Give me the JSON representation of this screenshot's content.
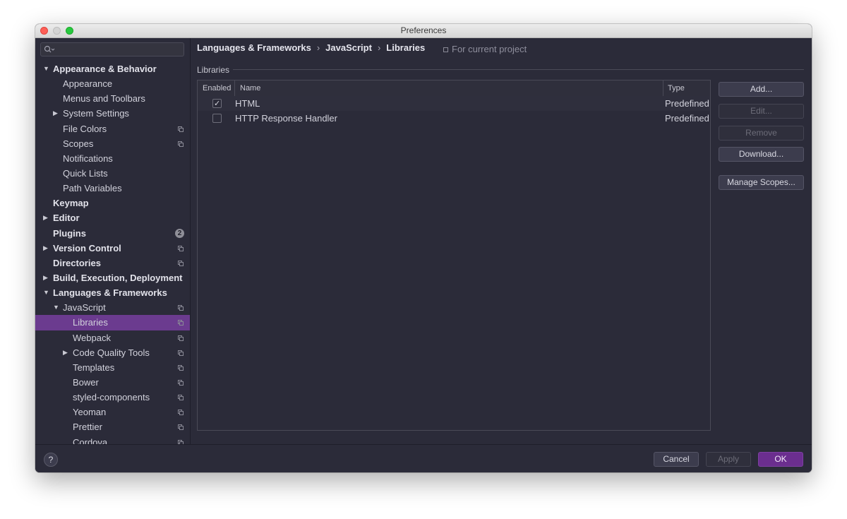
{
  "window": {
    "title": "Preferences"
  },
  "search": {
    "placeholder": ""
  },
  "sidebar": {
    "items": [
      {
        "label": "Appearance & Behavior",
        "bold": true,
        "level": 0,
        "arrow": "down",
        "copy": false
      },
      {
        "label": "Appearance",
        "bold": false,
        "level": 1,
        "arrow": "",
        "copy": false
      },
      {
        "label": "Menus and Toolbars",
        "bold": false,
        "level": 1,
        "arrow": "",
        "copy": false
      },
      {
        "label": "System Settings",
        "bold": false,
        "level": 1,
        "arrow": "right",
        "copy": false
      },
      {
        "label": "File Colors",
        "bold": false,
        "level": 1,
        "arrow": "",
        "copy": true
      },
      {
        "label": "Scopes",
        "bold": false,
        "level": 1,
        "arrow": "",
        "copy": true
      },
      {
        "label": "Notifications",
        "bold": false,
        "level": 1,
        "arrow": "",
        "copy": false
      },
      {
        "label": "Quick Lists",
        "bold": false,
        "level": 1,
        "arrow": "",
        "copy": false
      },
      {
        "label": "Path Variables",
        "bold": false,
        "level": 1,
        "arrow": "",
        "copy": false
      },
      {
        "label": "Keymap",
        "bold": true,
        "level": 0,
        "arrow": "",
        "copy": false
      },
      {
        "label": "Editor",
        "bold": true,
        "level": 0,
        "arrow": "right",
        "copy": false
      },
      {
        "label": "Plugins",
        "bold": true,
        "level": 0,
        "arrow": "",
        "copy": false,
        "badge": "2"
      },
      {
        "label": "Version Control",
        "bold": true,
        "level": 0,
        "arrow": "right",
        "copy": true
      },
      {
        "label": "Directories",
        "bold": true,
        "level": 0,
        "arrow": "",
        "copy": true
      },
      {
        "label": "Build, Execution, Deployment",
        "bold": true,
        "level": 0,
        "arrow": "right",
        "copy": false
      },
      {
        "label": "Languages & Frameworks",
        "bold": true,
        "level": 0,
        "arrow": "down",
        "copy": false
      },
      {
        "label": "JavaScript",
        "bold": false,
        "level": 1,
        "arrow": "down",
        "copy": true
      },
      {
        "label": "Libraries",
        "bold": false,
        "level": 2,
        "arrow": "",
        "copy": true,
        "selected": true
      },
      {
        "label": "Webpack",
        "bold": false,
        "level": 2,
        "arrow": "",
        "copy": true
      },
      {
        "label": "Code Quality Tools",
        "bold": false,
        "level": 2,
        "arrow": "right",
        "copy": true
      },
      {
        "label": "Templates",
        "bold": false,
        "level": 2,
        "arrow": "",
        "copy": true
      },
      {
        "label": "Bower",
        "bold": false,
        "level": 2,
        "arrow": "",
        "copy": true
      },
      {
        "label": "styled-components",
        "bold": false,
        "level": 2,
        "arrow": "",
        "copy": true
      },
      {
        "label": "Yeoman",
        "bold": false,
        "level": 2,
        "arrow": "",
        "copy": true
      },
      {
        "label": "Prettier",
        "bold": false,
        "level": 2,
        "arrow": "",
        "copy": true
      },
      {
        "label": "Cordova",
        "bold": false,
        "level": 2,
        "arrow": "",
        "copy": true
      }
    ]
  },
  "breadcrumb": [
    "Languages & Frameworks",
    "JavaScript",
    "Libraries"
  ],
  "scope_note": "For current project",
  "section": {
    "label": "Libraries"
  },
  "table": {
    "headers": {
      "enabled": "Enabled",
      "name": "Name",
      "type": "Type"
    },
    "rows": [
      {
        "enabled": true,
        "name": "HTML",
        "type": "Predefined"
      },
      {
        "enabled": false,
        "name": "HTTP Response Handler",
        "type": "Predefined"
      }
    ]
  },
  "buttons": {
    "add": "Add...",
    "edit": "Edit...",
    "remove": "Remove",
    "download": "Download...",
    "manage_scopes": "Manage Scopes..."
  },
  "footer": {
    "help": "?",
    "cancel": "Cancel",
    "apply": "Apply",
    "ok": "OK"
  },
  "colors": {
    "background": "#2b2b39",
    "accent": "#6b3b8f",
    "primary_button": "#6b2e8f"
  }
}
